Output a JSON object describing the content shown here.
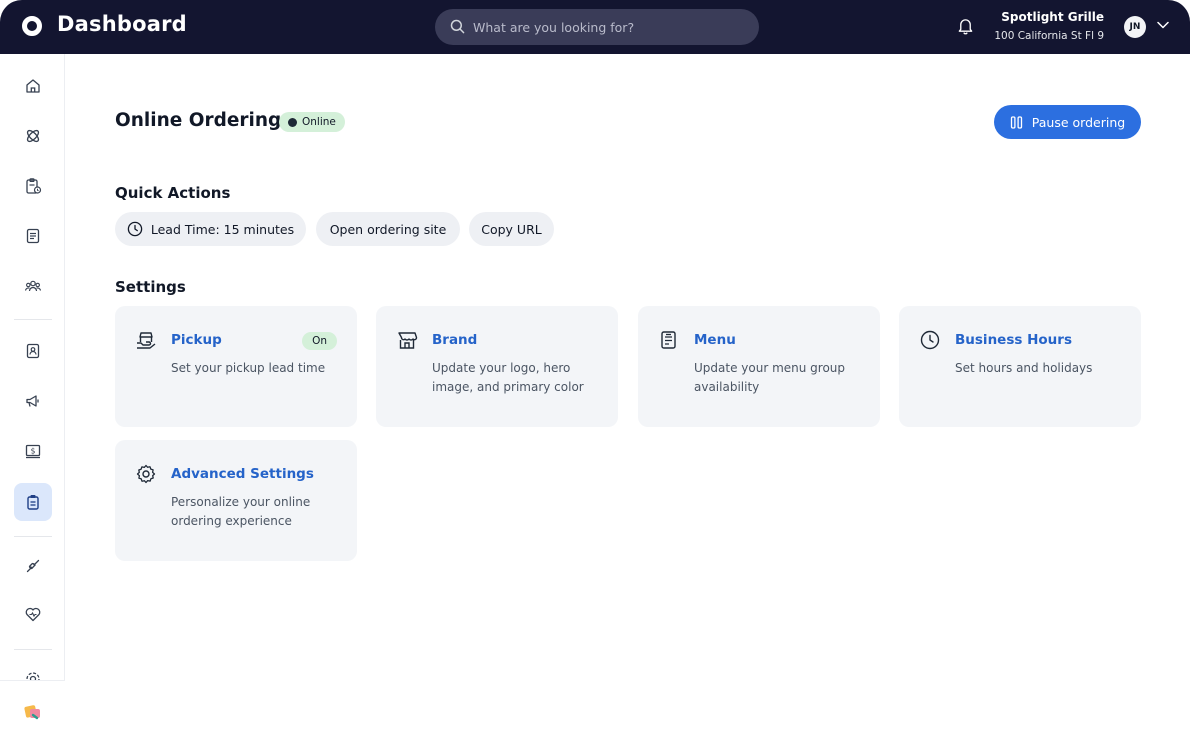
{
  "app": {
    "title": "Dashboard"
  },
  "search": {
    "placeholder": "What are you looking for?"
  },
  "account": {
    "name": "Spotlight Grille",
    "address": "100 California St Fl 9",
    "initials": "JN"
  },
  "sidebar": {
    "items": [
      {
        "name": "home-icon"
      },
      {
        "name": "orders-icon"
      },
      {
        "name": "clipboard-icon"
      },
      {
        "name": "menu-icon"
      },
      {
        "name": "team-icon"
      },
      {
        "name": "contacts-icon"
      },
      {
        "name": "marketing-icon"
      },
      {
        "name": "payments-icon"
      },
      {
        "name": "online-ordering-icon",
        "active": true
      },
      {
        "name": "integrations-icon"
      },
      {
        "name": "support-icon"
      },
      {
        "name": "settings-icon"
      },
      {
        "name": "apps-icon"
      }
    ]
  },
  "page": {
    "title": "Online Ordering",
    "status": "Online",
    "pause_label": "Pause ordering"
  },
  "quick_actions": {
    "title": "Quick Actions",
    "lead_time": "Lead Time: 15 minutes",
    "open_site": "Open ordering site",
    "copy_url": "Copy URL"
  },
  "settings": {
    "title": "Settings",
    "cards": [
      {
        "title": "Pickup",
        "desc": "Set your pickup lead time",
        "badge": "On",
        "icon": "pickup-icon"
      },
      {
        "title": "Brand",
        "desc": "Update your logo, hero image, and primary color",
        "icon": "store-icon"
      },
      {
        "title": "Menu",
        "desc": "Update your menu group availability",
        "icon": "menu-doc-icon"
      },
      {
        "title": "Business Hours",
        "desc": "Set hours and holidays",
        "icon": "clock-icon"
      },
      {
        "title": "Advanced Settings",
        "desc": "Personalize your online ordering experience",
        "icon": "gear-icon"
      }
    ]
  },
  "colors": {
    "topbar": "#131530",
    "accent": "#2c6fe0",
    "link": "#2563c9",
    "success_bg": "#d4f0d9"
  }
}
